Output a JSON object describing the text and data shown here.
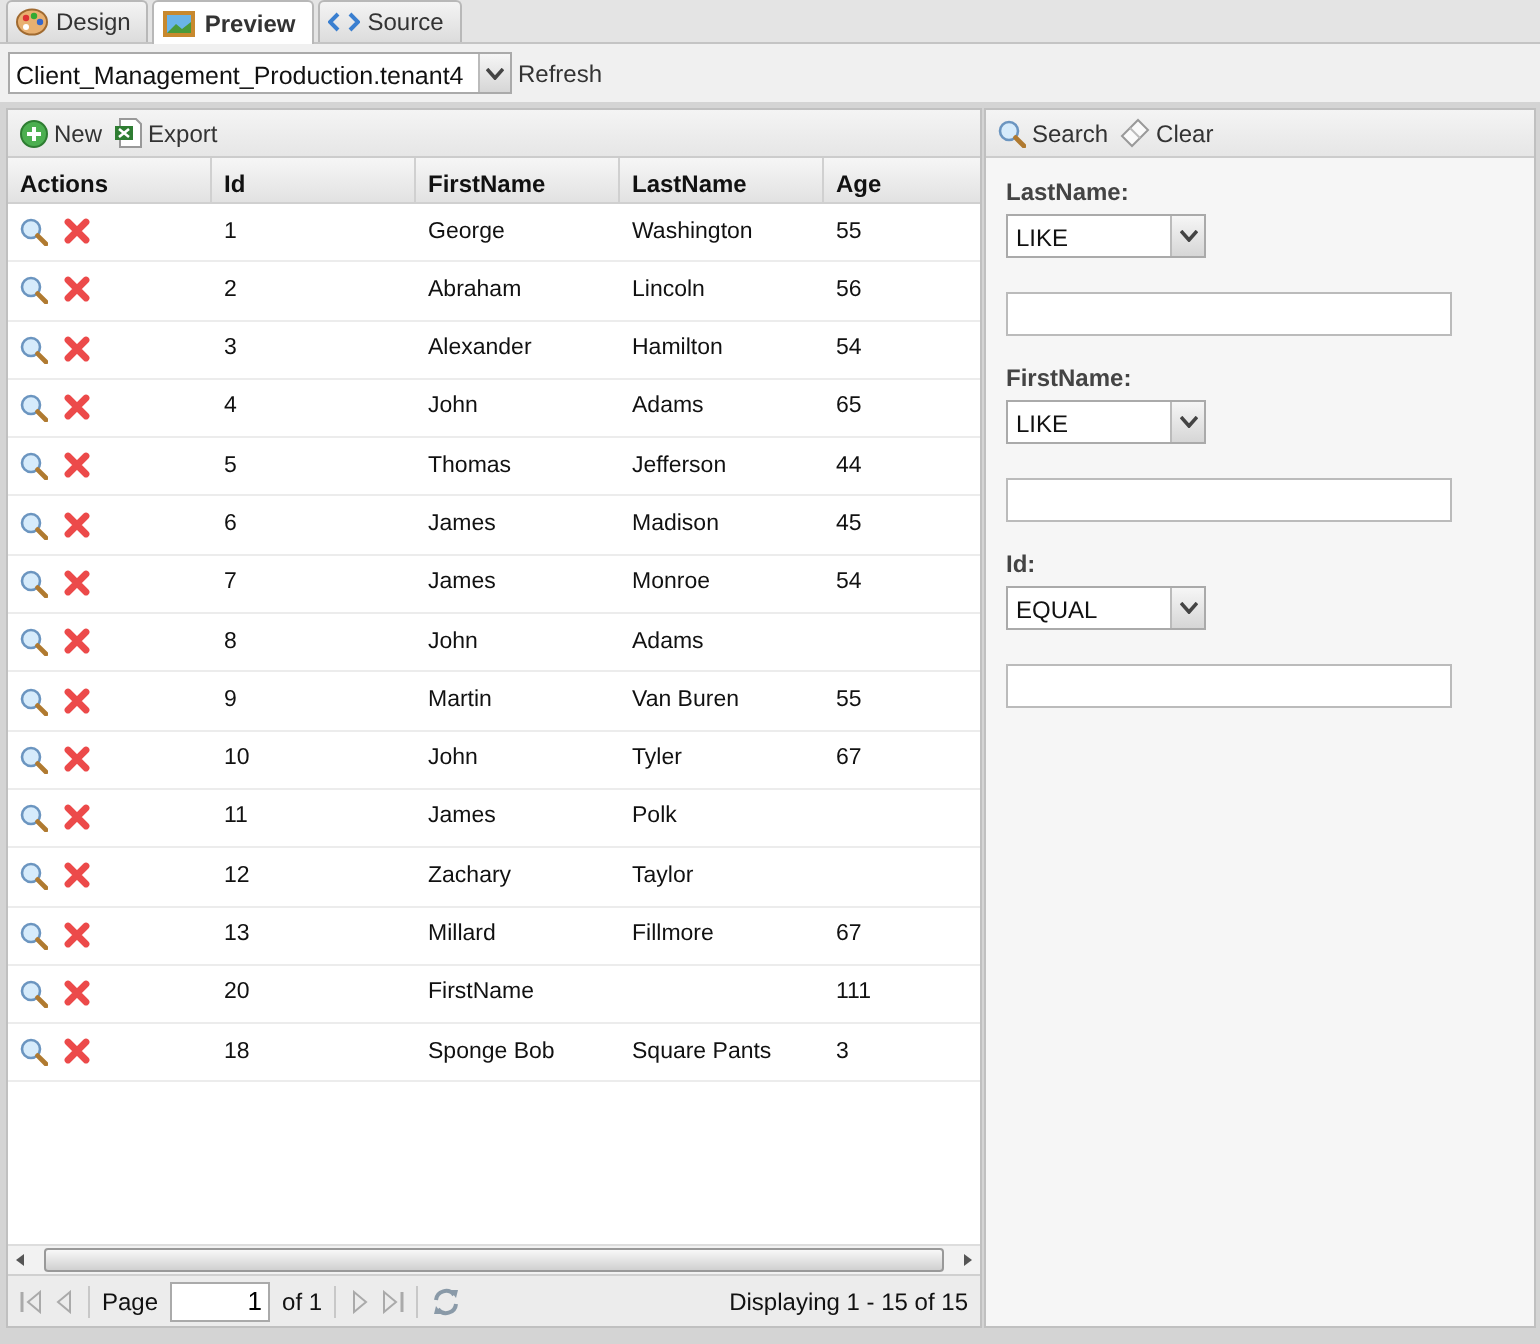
{
  "tabs": [
    {
      "label": "Design",
      "kind": "design",
      "selected": false
    },
    {
      "label": "Preview",
      "kind": "preview",
      "selected": true
    },
    {
      "label": "Source",
      "kind": "source",
      "selected": false
    }
  ],
  "datasource": {
    "value": "Client_Management_Production.tenant4",
    "refresh": "Refresh"
  },
  "grid_toolbar": [
    {
      "label": "New",
      "kind": "add"
    },
    {
      "label": "Export",
      "kind": "excel"
    }
  ],
  "table": {
    "columns": [
      "Actions",
      "Id",
      "FirstName",
      "LastName",
      "Age"
    ],
    "rows": [
      {
        "id": "1",
        "first_name": "George",
        "last_name": "Washington",
        "age": "55"
      },
      {
        "id": "2",
        "first_name": "Abraham",
        "last_name": "Lincoln",
        "age": "56"
      },
      {
        "id": "3",
        "first_name": "Alexander",
        "last_name": "Hamilton",
        "age": "54"
      },
      {
        "id": "4",
        "first_name": "John",
        "last_name": "Adams",
        "age": "65"
      },
      {
        "id": "5",
        "first_name": "Thomas",
        "last_name": "Jefferson",
        "age": "44"
      },
      {
        "id": "6",
        "first_name": "James",
        "last_name": "Madison",
        "age": "45"
      },
      {
        "id": "7",
        "first_name": "James",
        "last_name": "Monroe",
        "age": "54"
      },
      {
        "id": "8",
        "first_name": "John",
        "last_name": "Adams"
      },
      {
        "id": "9",
        "first_name": "Martin",
        "last_name": "Van Buren",
        "age": "55"
      },
      {
        "id": "10",
        "first_name": "John",
        "last_name": "Tyler",
        "age": "67"
      },
      {
        "id": "11",
        "first_name": "James",
        "last_name": "Polk"
      },
      {
        "id": "12",
        "first_name": "Zachary",
        "last_name": "Taylor"
      },
      {
        "id": "13",
        "first_name": "Millard",
        "last_name": "Fillmore",
        "age": "67"
      },
      {
        "id": "20",
        "first_name": "FirstName",
        "age": "111"
      },
      {
        "id": "18",
        "first_name": "Sponge Bob",
        "last_name": "Square Pants",
        "age": "3"
      }
    ]
  },
  "pager": {
    "page_label": "Page",
    "page": "1",
    "of": "of 1",
    "display": "Displaying 1 - 15 of 15"
  },
  "filter_toolbar": [
    {
      "label": "Search",
      "kind": "search"
    },
    {
      "label": "Clear",
      "kind": "clear"
    }
  ],
  "filters": [
    {
      "label": "LastName:",
      "operator": "LIKE"
    },
    {
      "label": "FirstName:",
      "operator": "LIKE"
    },
    {
      "label": "Id:",
      "operator": "EQUAL"
    }
  ]
}
